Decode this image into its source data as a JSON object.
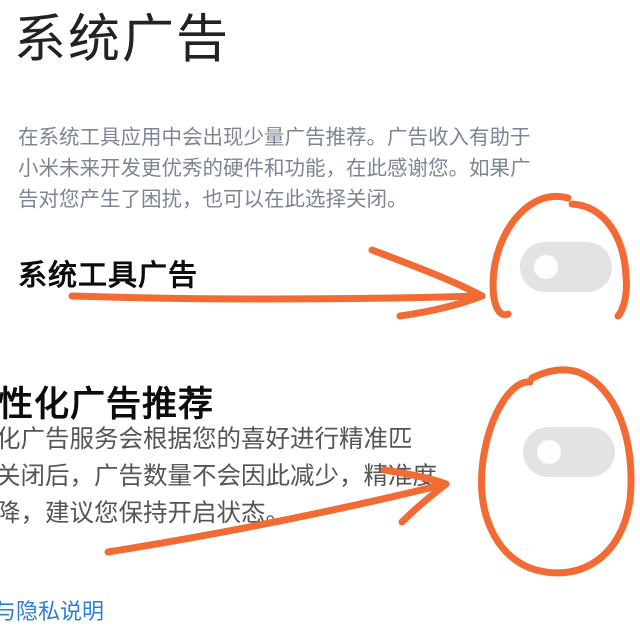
{
  "page_title": "系统广告",
  "description_lines": [
    "在系统工具应用中会出现少量广告推荐。广告收入有助于",
    "小米未来开发更优秀的硬件和功能，在此感谢您。如果广",
    "告对您产生了困扰，也可以在此选择关闭。"
  ],
  "settings": [
    {
      "title": "系统工具广告",
      "toggle_state": "off"
    },
    {
      "title": "性化广告推荐",
      "description_lines": [
        "化广告服务会根据您的喜好进行精准匹",
        "关闭后，广告数量不会因此减少，精准度",
        "降，建议您保持开启状态。"
      ],
      "toggle_state": "off"
    }
  ],
  "privacy_link": "与隐私说明",
  "colors": {
    "annotation": "#f26a34",
    "toggle_off": "#e3e3e3",
    "link": "#2d7fd6",
    "description": "#7c8596"
  }
}
